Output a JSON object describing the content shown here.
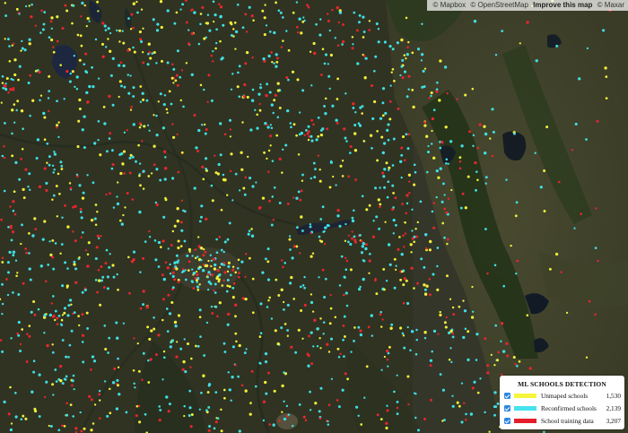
{
  "map": {
    "background": "#2f3121",
    "point_colors": {
      "unmapped": "#f0f03a",
      "reconfirmed": "#3ee0e6",
      "training": "#e8262e"
    }
  },
  "attribution": {
    "mapbox": "© Mapbox",
    "osm": "© OpenStreetMap",
    "improve": "Improve this map",
    "maxar": "© Maxar"
  },
  "legend": {
    "title": "ML SCHOOLS DETECTION",
    "items": [
      {
        "label": "Unmaped schools",
        "count": "1,530",
        "color": "#f5f53c",
        "checked": true
      },
      {
        "label": "Reconfirmed schools",
        "count": "2,139",
        "color": "#46e2ee",
        "checked": true
      },
      {
        "label": "School training data",
        "count": "3,207",
        "color": "#e41e2a",
        "checked": true
      }
    ]
  }
}
